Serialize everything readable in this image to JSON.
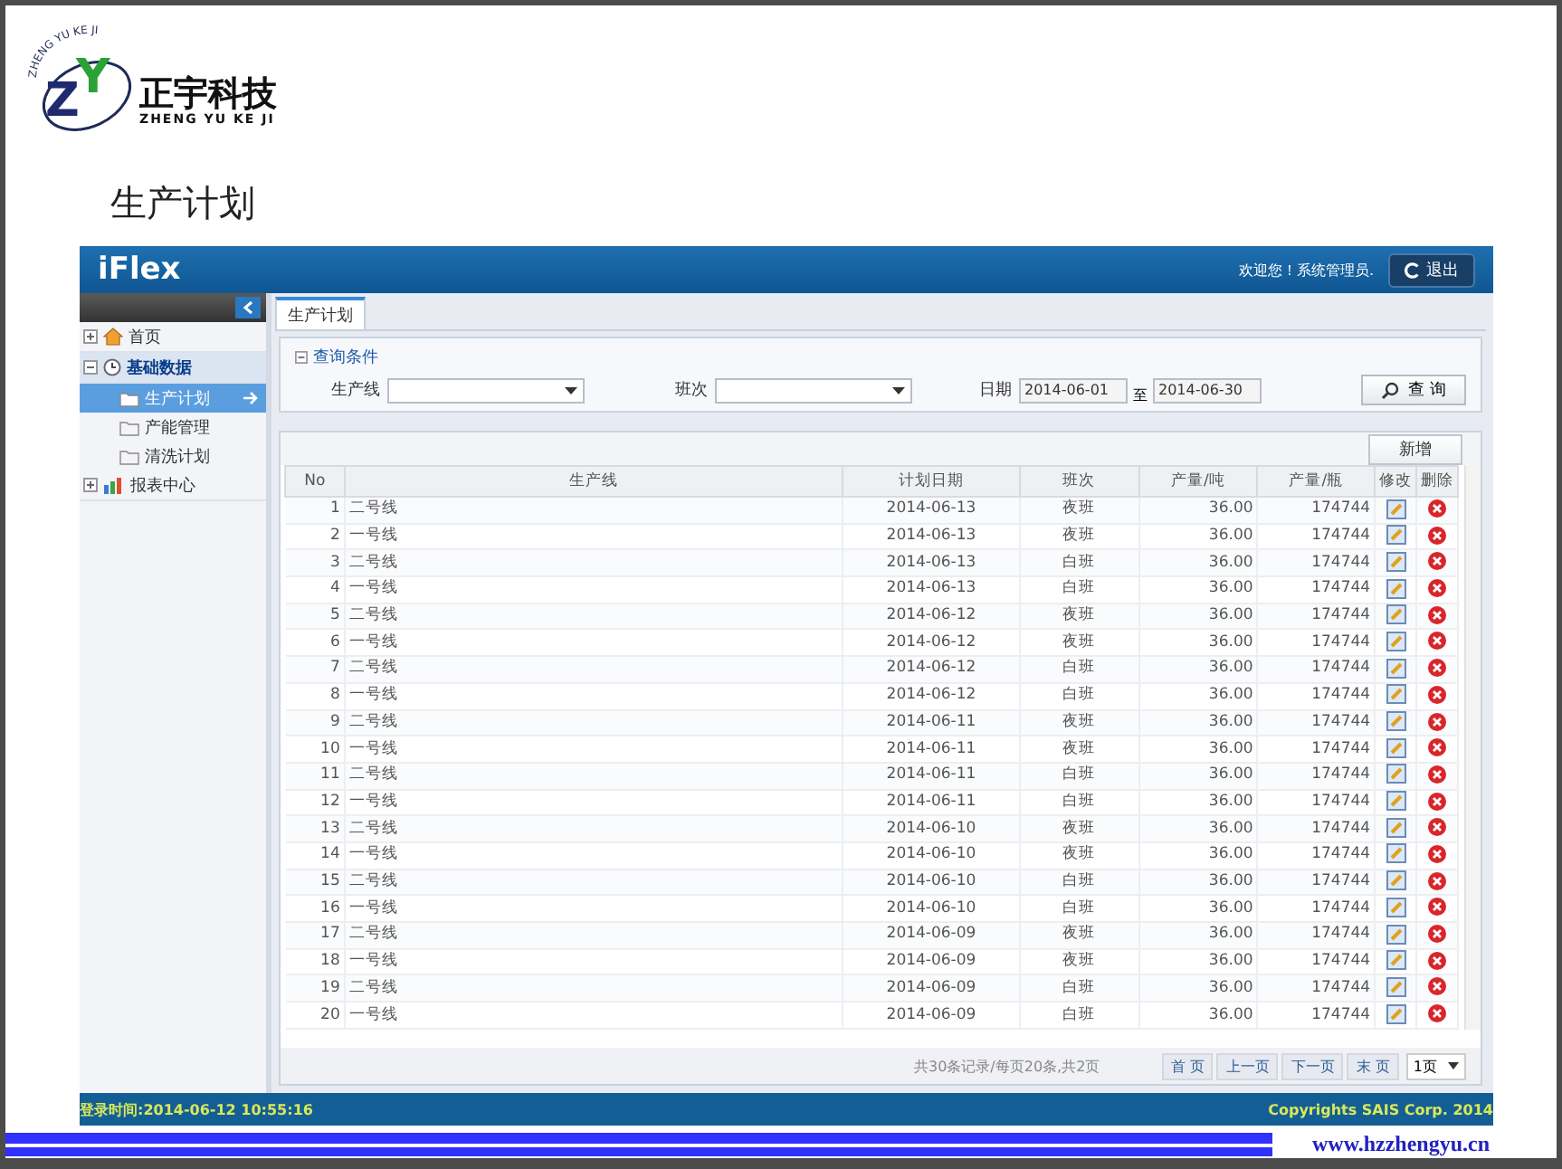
{
  "logo": {
    "mark_z": "Z",
    "mark_y": "Y",
    "ring_text": "ZHENG YU KE JI",
    "name": "正宇科技",
    "pinyin": "ZHENG YU KE JI"
  },
  "slide_title": "生产计划",
  "app": {
    "brand": "iFlex",
    "welcome": "欢迎您！系统管理员.",
    "logout": "退出"
  },
  "sidebar": {
    "items": [
      {
        "label": "首页",
        "expanded": false
      },
      {
        "label": "基础数据",
        "expanded": true,
        "children": [
          {
            "label": "生产计划",
            "selected": true
          },
          {
            "label": "产能管理",
            "selected": false
          },
          {
            "label": "清洗计划",
            "selected": false
          }
        ]
      },
      {
        "label": "报表中心",
        "expanded": false
      }
    ]
  },
  "tabs": [
    {
      "label": "生产计划",
      "selected": true
    }
  ],
  "query": {
    "legend": "查询条件",
    "line_label": "生产线",
    "shift_label": "班次",
    "date_label": "日期",
    "date_from": "2014-06-01",
    "date_sep": "至",
    "date_to": "2014-06-30",
    "search_button": "查 询"
  },
  "grid": {
    "add_button": "新增",
    "columns": [
      "No",
      "生产线",
      "计划日期",
      "班次",
      "产量/吨",
      "产量/瓶",
      "修改",
      "删除"
    ],
    "rows": [
      [
        "1",
        "二号线",
        "2014-06-13",
        "夜班",
        "36.00",
        "174744"
      ],
      [
        "2",
        "一号线",
        "2014-06-13",
        "夜班",
        "36.00",
        "174744"
      ],
      [
        "3",
        "二号线",
        "2014-06-13",
        "白班",
        "36.00",
        "174744"
      ],
      [
        "4",
        "一号线",
        "2014-06-13",
        "白班",
        "36.00",
        "174744"
      ],
      [
        "5",
        "二号线",
        "2014-06-12",
        "夜班",
        "36.00",
        "174744"
      ],
      [
        "6",
        "一号线",
        "2014-06-12",
        "夜班",
        "36.00",
        "174744"
      ],
      [
        "7",
        "二号线",
        "2014-06-12",
        "白班",
        "36.00",
        "174744"
      ],
      [
        "8",
        "一号线",
        "2014-06-12",
        "白班",
        "36.00",
        "174744"
      ],
      [
        "9",
        "二号线",
        "2014-06-11",
        "夜班",
        "36.00",
        "174744"
      ],
      [
        "10",
        "一号线",
        "2014-06-11",
        "夜班",
        "36.00",
        "174744"
      ],
      [
        "11",
        "二号线",
        "2014-06-11",
        "白班",
        "36.00",
        "174744"
      ],
      [
        "12",
        "一号线",
        "2014-06-11",
        "白班",
        "36.00",
        "174744"
      ],
      [
        "13",
        "二号线",
        "2014-06-10",
        "夜班",
        "36.00",
        "174744"
      ],
      [
        "14",
        "一号线",
        "2014-06-10",
        "夜班",
        "36.00",
        "174744"
      ],
      [
        "15",
        "二号线",
        "2014-06-10",
        "白班",
        "36.00",
        "174744"
      ],
      [
        "16",
        "一号线",
        "2014-06-10",
        "白班",
        "36.00",
        "174744"
      ],
      [
        "17",
        "二号线",
        "2014-06-09",
        "夜班",
        "36.00",
        "174744"
      ],
      [
        "18",
        "一号线",
        "2014-06-09",
        "夜班",
        "36.00",
        "174744"
      ],
      [
        "19",
        "二号线",
        "2014-06-09",
        "白班",
        "36.00",
        "174744"
      ],
      [
        "20",
        "一号线",
        "2014-06-09",
        "白班",
        "36.00",
        "174744"
      ]
    ],
    "pager": {
      "summary": "共30条记录/每页20条,共2页",
      "buttons": [
        "首 页",
        "上一页",
        "下一页",
        "末 页"
      ],
      "page_select": "1页"
    }
  },
  "status_bar": {
    "login_time": "登录时间:2014-06-12 10:55:16",
    "copyright": "Copyrights SAIS Corp. 2014"
  },
  "slide_footer": {
    "url": "www.hzzhengyu.cn"
  }
}
